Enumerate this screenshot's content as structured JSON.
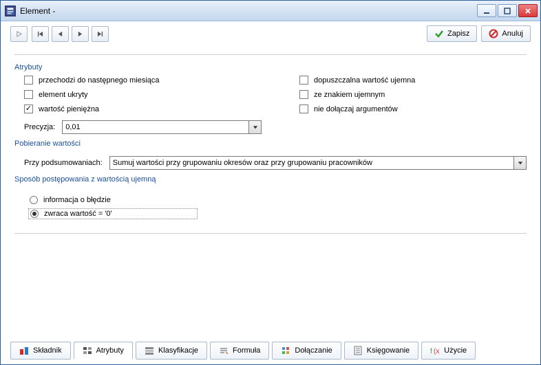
{
  "window": {
    "title": "Element -"
  },
  "toolbar": {
    "save": "Zapisz",
    "cancel": "Anuluj"
  },
  "sections": {
    "attributes": "Atrybuty",
    "retrieval": "Pobieranie wartości",
    "negative_handling": "Sposób postępowania z wartością ujemną"
  },
  "attributes": {
    "next_month": "przechodzi do następnego miesiąca",
    "hidden_element": "element ukryty",
    "money_value": "wartość pieniężna",
    "allow_negative": "dopuszczalna wartość ujemna",
    "negative_sign": "ze znakiem ujemnym",
    "no_args": "nie dołączaj argumentów",
    "checked": {
      "next_month": false,
      "hidden_element": false,
      "money_value": true,
      "allow_negative": false,
      "negative_sign": false,
      "no_args": false
    }
  },
  "precision": {
    "label": "Precyzja:",
    "value": "0,01"
  },
  "retrieval": {
    "label": "Przy podsumowaniach:",
    "value": "Sumuj wartości przy grupowaniu okresów oraz przy grupowaniu pracowników"
  },
  "negative": {
    "error_info": "informacja o błędzie",
    "return_zero": "zwraca wartość = '0'",
    "selected": "return_zero"
  },
  "tabs": [
    "Składnik",
    "Atrybuty",
    "Klasyfikacje",
    "Formuła",
    "Dołączanie",
    "Księgowanie",
    "Użycie"
  ]
}
